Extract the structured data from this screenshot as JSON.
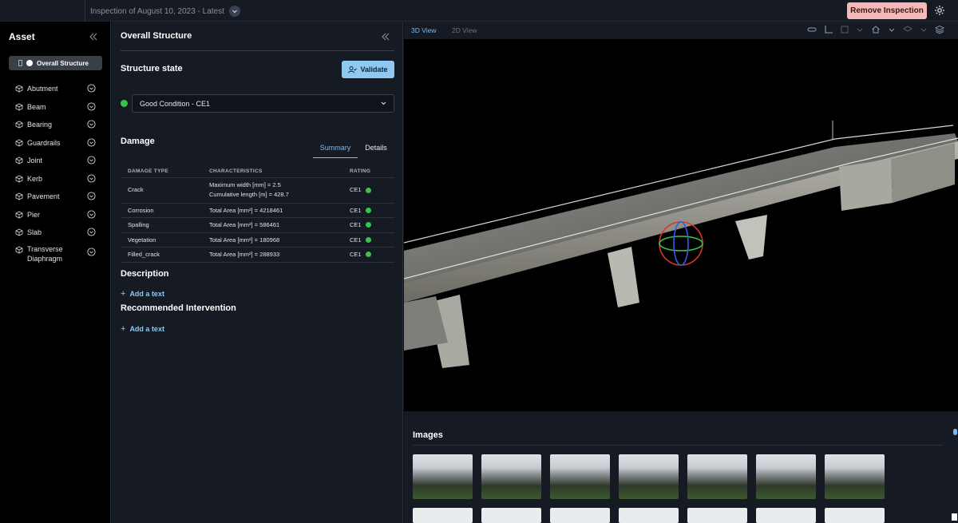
{
  "header": {
    "inspection_label": "Inspection of August 10, 2023 - Latest",
    "remove_button": "Remove Inspection"
  },
  "sidebar": {
    "title": "Asset",
    "overall": "Overall Structure",
    "items": [
      {
        "label": "Abutment"
      },
      {
        "label": "Beam"
      },
      {
        "label": "Bearing"
      },
      {
        "label": "Guardrails"
      },
      {
        "label": "Joint"
      },
      {
        "label": "Kerb"
      },
      {
        "label": "Pavement"
      },
      {
        "label": "Pier"
      },
      {
        "label": "Slab"
      },
      {
        "label": "Transverse Diaphragm"
      }
    ]
  },
  "panel": {
    "title": "Overall Structure",
    "structure_state_title": "Structure state",
    "validate_label": "Validate",
    "condition": "Good Condition - CE1",
    "condition_color": "#3bc24a",
    "damage_title": "Damage",
    "tabs": {
      "summary": "Summary",
      "details": "Details"
    },
    "table": {
      "headers": [
        "DAMAGE TYPE",
        "CHARACTERISTICS",
        "RATING"
      ],
      "rows": [
        {
          "type": "Crack",
          "char1": "Maximum width [mm] = 2.5",
          "char2": "Cumulative length [m] = 428.7",
          "rating": "CE1"
        },
        {
          "type": "Corrosion",
          "char1": "Total Area [mm²] = 4218461",
          "rating": "CE1"
        },
        {
          "type": "Spalling",
          "char1": "Total Area [mm²] = 586461",
          "rating": "CE1"
        },
        {
          "type": "Vegetation",
          "char1": "Total Area [mm²] = 180968",
          "rating": "CE1"
        },
        {
          "type": "Filled_crack",
          "char1": "Total Area [mm²] = 288933",
          "rating": "CE1"
        }
      ]
    },
    "description_title": "Description",
    "add_text": "Add a text",
    "recommended_title": "Recommended Intervention"
  },
  "viewer": {
    "tab_3d": "3D View",
    "tab_2d": "2D View",
    "images_title": "Images"
  },
  "colors": {
    "accent": "#79b8f0",
    "danger_button": "#f4b9b9",
    "validate_button": "#8fc8f0"
  }
}
